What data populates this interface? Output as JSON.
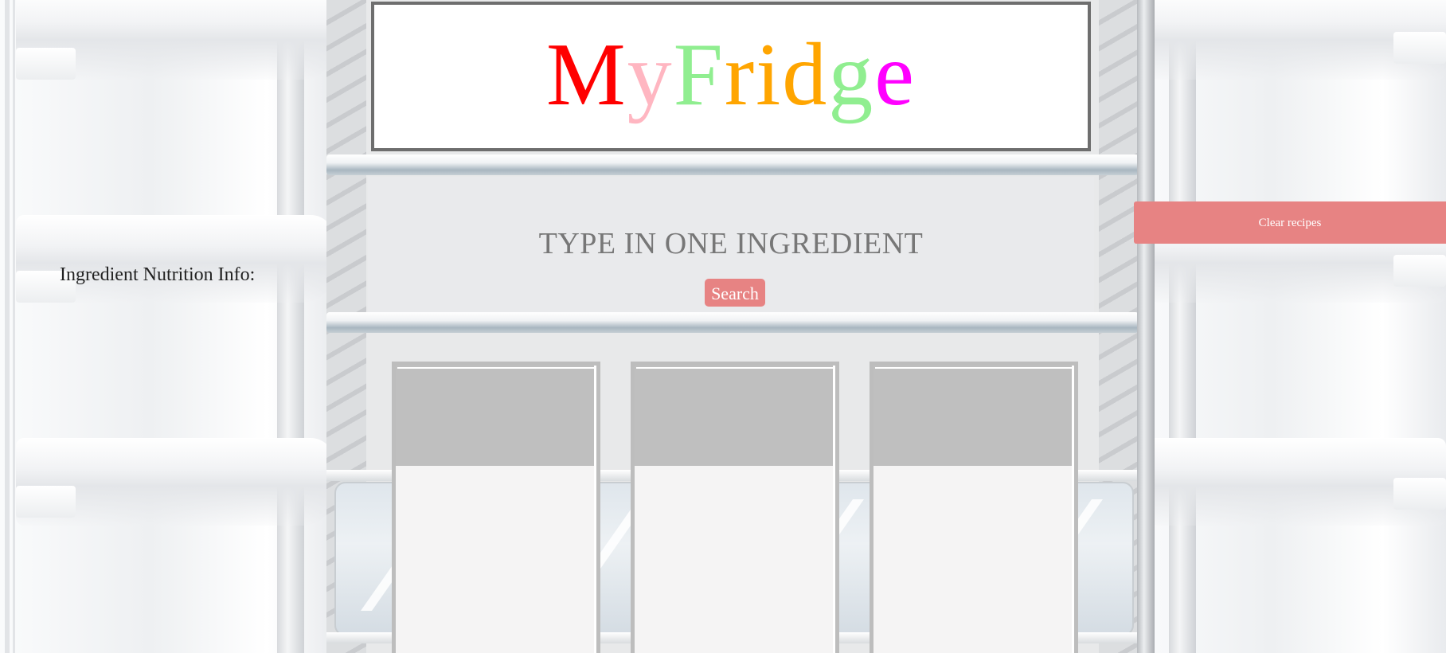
{
  "header": {
    "title_letters": [
      {
        "char": "M",
        "color": "#ff0000"
      },
      {
        "char": "y",
        "color": "#ffb6c1"
      },
      {
        "char": "F",
        "color": "#90ee90"
      },
      {
        "char": "r",
        "color": "#ffa500"
      },
      {
        "char": "i",
        "color": "#ffa500"
      },
      {
        "char": "d",
        "color": "#ffa500"
      },
      {
        "char": "g",
        "color": "#90ee90"
      },
      {
        "char": "e",
        "color": "#ff00ff"
      }
    ]
  },
  "search": {
    "heading": "TYPE IN ONE INGREDIENT",
    "button_label": "Search"
  },
  "nutrition": {
    "label": "Ingredient Nutrition Info:"
  },
  "recipes": {
    "clear_label": "Clear recipes",
    "cards": [
      {},
      {},
      {}
    ]
  },
  "colors": {
    "accent": "#e78383",
    "title_border": "#6e6e6e"
  }
}
